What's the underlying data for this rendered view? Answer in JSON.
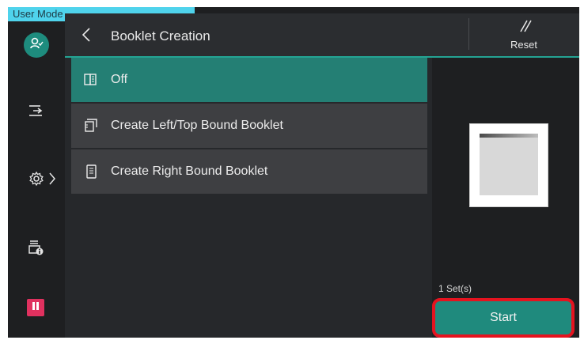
{
  "mode_label": "User Mode",
  "header": {
    "title": "Booklet Creation",
    "reset_label": "Reset"
  },
  "options": [
    {
      "label": "Off",
      "icon": "booklet-off-icon",
      "selected": true
    },
    {
      "label": "Create Left/Top Bound Booklet",
      "icon": "left-bound-booklet-icon",
      "selected": false
    },
    {
      "label": "Create Right Bound Booklet",
      "icon": "right-bound-booklet-icon",
      "selected": false
    }
  ],
  "preview": {
    "sets_label": "1 Set(s)"
  },
  "start_label": "Start",
  "sidebar": {
    "icons": [
      "user-icon",
      "input-icon",
      "settings-icon",
      "job-status-icon",
      "pause-icon"
    ]
  },
  "colors": {
    "accent": "#24a393",
    "selected": "#247f74",
    "pause": "#e0315f",
    "highlight_border": "#e5131f",
    "user_mode_bar": "#4fd3ec"
  }
}
